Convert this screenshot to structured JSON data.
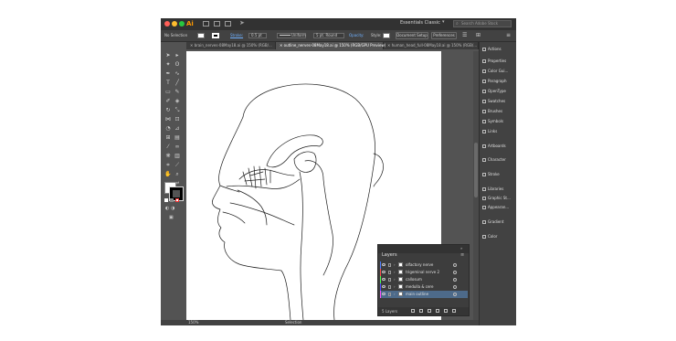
{
  "app": {
    "logo": "Ai"
  },
  "titlebar": {
    "workspace": "Essentials Classic",
    "search_placeholder": "Search Adobe Stock"
  },
  "control_bar": {
    "selection_label": "No Selection",
    "stroke_label": "Stroke:",
    "stroke_weight": "0.5 pt",
    "profile": "Uniform",
    "brush": "5 pt. Round",
    "opacity_label": "Opacity:",
    "style_label": "Style:",
    "document_setup": "Document Setup",
    "preferences": "Preferences"
  },
  "tabs": [
    {
      "label": "brain_nerves-08May18.ai @ 150% (RGB/...",
      "active": false
    },
    {
      "label": "outline_nerves-08May18.ai @ 150% (RGB/GPU Preview)",
      "active": true
    },
    {
      "label": "human_head_full-08May18.ai @ 150% (RGB/...",
      "active": false
    }
  ],
  "panels": [
    {
      "label": "Actions",
      "icon": "actions-icon"
    },
    {
      "label": "Properties",
      "icon": "properties-icon"
    },
    {
      "label": "Color Gui...",
      "icon": "color-guide-icon"
    },
    {
      "label": "Paragraph",
      "icon": "paragraph-icon"
    },
    {
      "label": "OpenType",
      "icon": "opentype-icon"
    },
    {
      "label": "Swatches",
      "icon": "swatches-icon"
    },
    {
      "label": "Brushes",
      "icon": "brushes-icon"
    },
    {
      "label": "Symbols",
      "icon": "symbols-icon"
    },
    {
      "label": "Links",
      "icon": "links-icon"
    },
    {
      "label": "Artboards",
      "icon": "artboards-icon"
    },
    {
      "label": "Character",
      "icon": "character-icon"
    },
    {
      "label": "Stroke",
      "icon": "stroke-icon"
    },
    {
      "label": "Libraries",
      "icon": "libraries-icon"
    },
    {
      "label": "Graphic St...",
      "icon": "graphic-styles-icon"
    },
    {
      "label": "Appearan...",
      "icon": "appearance-icon"
    },
    {
      "label": "Gradient",
      "icon": "gradient-icon"
    },
    {
      "label": "Color",
      "icon": "color-icon"
    }
  ],
  "layers_panel": {
    "title": "Layers",
    "layers": [
      {
        "name": "olfactory nerve",
        "color": "#4f7fff",
        "selected": false
      },
      {
        "name": "trigeminal nerve 2",
        "color": "#ff4f4f",
        "selected": false
      },
      {
        "name": "callosum",
        "color": "#4fff4f",
        "selected": false
      },
      {
        "name": "medulla & cere",
        "color": "#4f4fff",
        "selected": false
      },
      {
        "name": "main outline",
        "color": "#ff4fff",
        "selected": true
      }
    ],
    "footer": "5 Layers"
  },
  "status": {
    "zoom": "150%",
    "tool": "Selection"
  }
}
